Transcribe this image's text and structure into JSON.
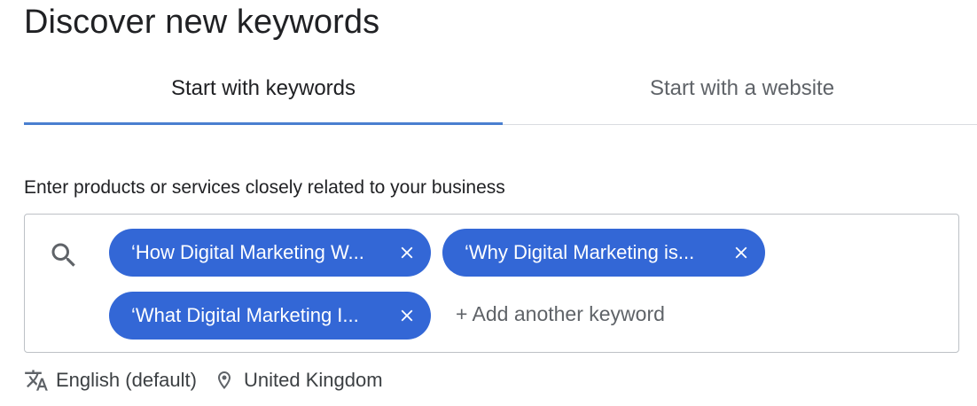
{
  "page": {
    "title": "Discover new keywords"
  },
  "tabs": [
    {
      "label": "Start with keywords",
      "active": true
    },
    {
      "label": "Start with a website",
      "active": false
    }
  ],
  "keyword_section": {
    "prompt": "Enter products or services closely related to your business",
    "chips": [
      {
        "label": "‘How Digital Marketing W..."
      },
      {
        "label": "‘Why Digital Marketing is..."
      },
      {
        "label": "‘What Digital Marketing I..."
      }
    ],
    "add_placeholder": "+ Add another keyword"
  },
  "settings": {
    "language": "English (default)",
    "location": "United Kingdom"
  },
  "colors": {
    "chip_background": "#3367d6",
    "tab_indicator": "#4a7fd0",
    "border": "#bdc1c6"
  },
  "icons": {
    "search": "search-icon",
    "close": "close-icon",
    "translate": "translate-icon",
    "location": "location-pin-icon"
  }
}
